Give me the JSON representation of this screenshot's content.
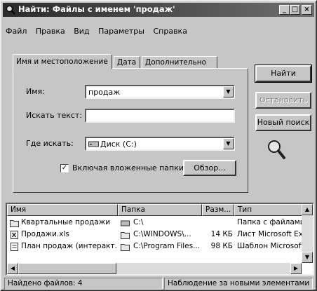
{
  "window": {
    "title": "Найти: Файлы с именем 'продаж'",
    "minimize": "_",
    "maximize": "□",
    "close": "×"
  },
  "menu": [
    "Файл",
    "Правка",
    "Вид",
    "Параметры",
    "Справка"
  ],
  "tabs": [
    "Имя и местоположение",
    "Дата",
    "Дополнительно"
  ],
  "form": {
    "name_label": "Имя:",
    "name_value": "продаж",
    "text_label": "Искать текст:",
    "text_value": "",
    "where_label": "Где искать:",
    "where_value": "Диск (C:)",
    "subfolders_label": "Включая вложенные папки",
    "subfolders_checked": true,
    "subfolders_mark": "✓",
    "browse_label": "Обзор..."
  },
  "buttons": {
    "find": "Найти",
    "stop": "Остановить",
    "new_search": "Новый поиск"
  },
  "results": {
    "columns": [
      "Имя",
      "Папка",
      "Разм...",
      "Тип"
    ],
    "rows": [
      {
        "name": "Квартальные продажи",
        "folder": "C:\\",
        "size": "",
        "type": "Папка с файлами",
        "icon": "folder-icon"
      },
      {
        "name": "Продажи.xls",
        "folder": "C:\\WINDOWS\\...",
        "size": "14 КБ",
        "type": "Лист Microsoft Exc",
        "icon": "excel-file-icon"
      },
      {
        "name": "План продаж (интеракт...",
        "folder": "C:\\Program Files...",
        "size": "98 КБ",
        "type": "Шаблон Microsoft F",
        "icon": "template-file-icon"
      }
    ]
  },
  "status": {
    "found": "Найдено файлов: 4",
    "monitor": "Наблюдение за новыми элементами"
  }
}
